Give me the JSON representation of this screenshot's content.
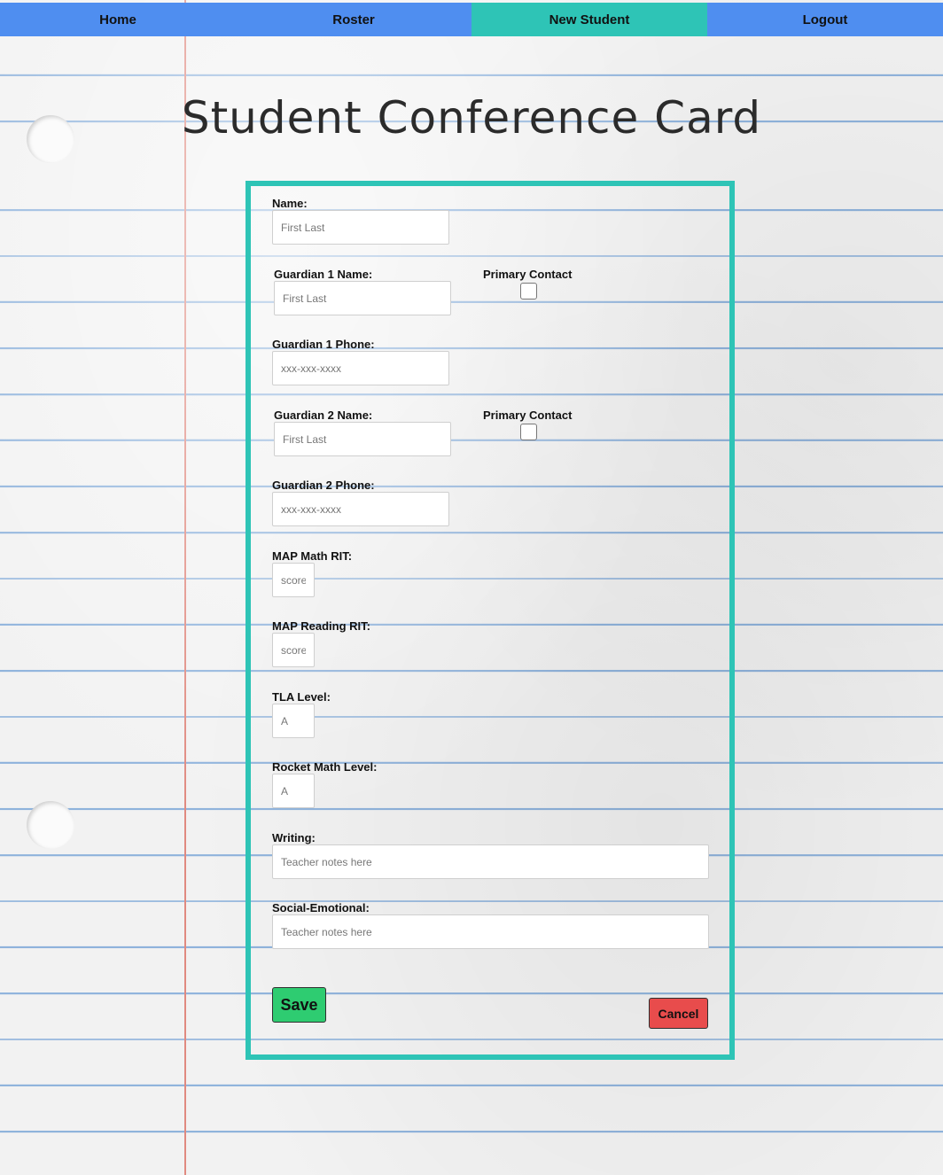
{
  "nav": {
    "items": [
      {
        "label": "Home",
        "active": false
      },
      {
        "label": "Roster",
        "active": false
      },
      {
        "label": "New Student",
        "active": true
      },
      {
        "label": "Logout",
        "active": false
      }
    ],
    "color": "#4f8ef0",
    "active_color": "#2ec4b6"
  },
  "page_title": "Student Conference Card",
  "form": {
    "name": {
      "label": "Name:",
      "placeholder": "First Last"
    },
    "guardian1_name": {
      "label": "Guardian 1 Name:",
      "placeholder": "First Last"
    },
    "guardian1_primary": {
      "label": "Primary Contact",
      "checked": false
    },
    "guardian1_phone": {
      "label": "Guardian 1 Phone:",
      "placeholder": "xxx-xxx-xxxx"
    },
    "guardian2_name": {
      "label": "Guardian 2 Name:",
      "placeholder": "First Last"
    },
    "guardian2_primary": {
      "label": "Primary Contact",
      "checked": false
    },
    "guardian2_phone": {
      "label": "Guardian 2 Phone:",
      "placeholder": "xxx-xxx-xxxx"
    },
    "map_math": {
      "label": "MAP Math RIT:",
      "placeholder": "score"
    },
    "map_reading": {
      "label": "MAP Reading RIT:",
      "placeholder": "score"
    },
    "tla_level": {
      "label": "TLA Level:",
      "placeholder": "A"
    },
    "rocket_math": {
      "label": "Rocket Math Level:",
      "placeholder": "A"
    },
    "writing": {
      "label": "Writing:",
      "placeholder": "Teacher notes here"
    },
    "social_emotional": {
      "label": "Social-Emotional:",
      "placeholder": "Teacher notes here"
    },
    "save_label": "Save",
    "cancel_label": "Cancel",
    "border_color": "#2ec4b6",
    "save_color": "#2ecc71",
    "cancel_color": "#e84c4c"
  }
}
